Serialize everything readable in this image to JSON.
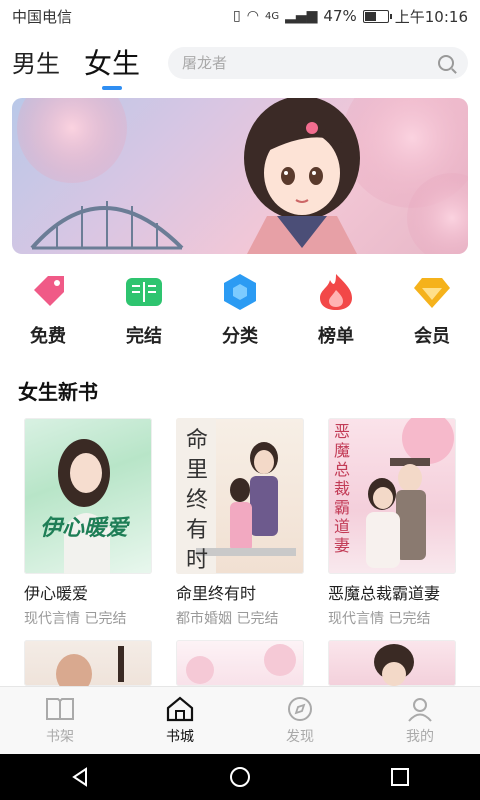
{
  "status_bar": {
    "carrier": "中国电信",
    "network": "4G",
    "battery": "47%",
    "time": "上午10:16"
  },
  "top_nav": {
    "tabs": [
      {
        "label": "男生",
        "active": false
      },
      {
        "label": "女生",
        "active": true
      }
    ],
    "search_placeholder": "屠龙者",
    "accent": "#2f8ef2"
  },
  "categories": [
    {
      "label": "免费",
      "icon": "tag-icon",
      "color": "#f05a87"
    },
    {
      "label": "完结",
      "icon": "book-open-icon",
      "color": "#2ec46f"
    },
    {
      "label": "分类",
      "icon": "hexagon-icon",
      "color": "#2b9bf3"
    },
    {
      "label": "榜单",
      "icon": "flame-icon",
      "color": "#f24848"
    },
    {
      "label": "会员",
      "icon": "diamond-icon",
      "color": "#f5b21b"
    }
  ],
  "section": {
    "title": "女生新书"
  },
  "books": [
    {
      "title": "伊心暖爱",
      "genre": "现代言情",
      "status": "已完结",
      "cover_text": "伊心暖爱"
    },
    {
      "title": "命里终有时",
      "genre": "都市婚姻",
      "status": "已完结",
      "cover_text": "命里终有时"
    },
    {
      "title": "恶魔总裁霸道妻",
      "genre": "现代言情",
      "status": "已完结",
      "cover_text": "恶魔总裁霸道妻"
    }
  ],
  "bottom_nav": [
    {
      "label": "书架",
      "icon": "bookshelf-icon",
      "active": false
    },
    {
      "label": "书城",
      "icon": "home-icon",
      "active": true
    },
    {
      "label": "发现",
      "icon": "compass-icon",
      "active": false
    },
    {
      "label": "我的",
      "icon": "user-icon",
      "active": false
    }
  ]
}
